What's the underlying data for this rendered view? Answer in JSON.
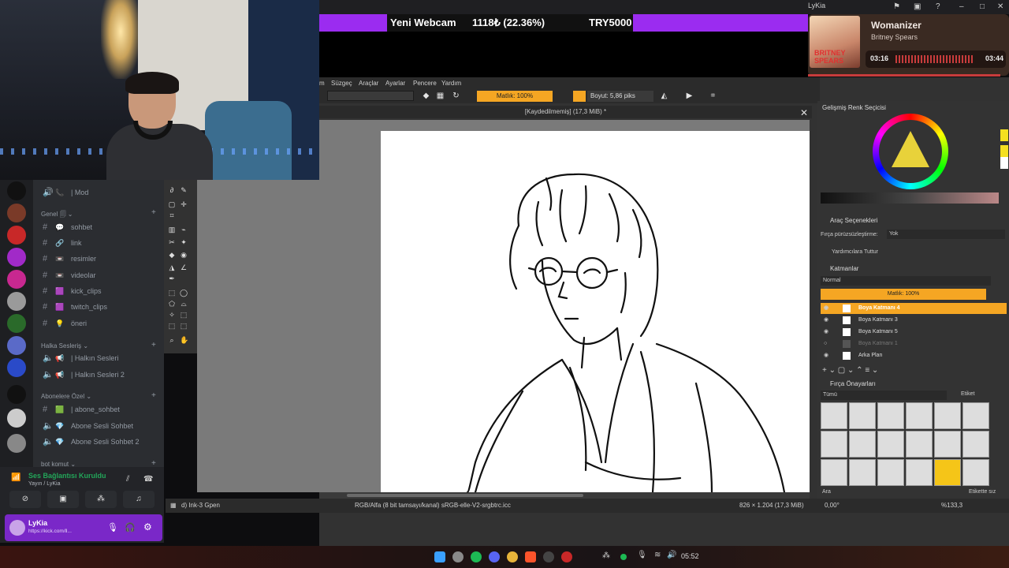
{
  "window": {
    "title": "LyKia"
  },
  "alert": {
    "label": "Yeni Webcam",
    "amount": "1118₺ (22.36%)",
    "goal": "TRY5000"
  },
  "music": {
    "title": "Womanizer",
    "artist": "Britney Spears",
    "elapsed": "03:16",
    "total": "03:44",
    "album_text": "BRITNEY SPEARS"
  },
  "krita": {
    "menu": [
      "m",
      "Süzgeç",
      "Araçlar",
      "Ayarlar",
      "Pencere",
      "Yardım"
    ],
    "opacity_label": "Matlık: 100%",
    "size_label": "Boyut: 5,86 piks",
    "document_title": "[Kaydedilmemiş]  (17,3 MiB) *",
    "status": {
      "brush": "d) Ink-3 Gpen",
      "color_profile": "RGB/Alfa (8 bit tamsayı/kanal) sRGB-elle-V2-srgbtrc.icc",
      "dimensions": "826 × 1.204 (17,3 MiB)",
      "rotation": "0,00°",
      "zoom": "%133,3"
    },
    "panels": {
      "color_selector": "Gelişmiş Renk Seçicisi",
      "tool_options": "Araç Seçenekleri",
      "smoothing_label": "Fırça pürüzsüzleştirme:",
      "smoothing_value": "Yok",
      "assistants_label": "Yardımcılara Tuttur",
      "layers": "Katmanlar",
      "blend_mode": "Normal",
      "layer_opacity": "Matlık:  100%",
      "layer_list": [
        {
          "name": "Boya Katmanı 4",
          "active": true,
          "dim": false
        },
        {
          "name": "Boya Katmanı 3",
          "active": false,
          "dim": false
        },
        {
          "name": "Boya Katmanı 5",
          "active": false,
          "dim": false
        },
        {
          "name": "Boya Katmanı 1",
          "active": false,
          "dim": true
        },
        {
          "name": "Arka Plan",
          "active": false,
          "dim": false
        }
      ],
      "brush_presets": "Fırça Önayarları",
      "presets_filter": "Tümü",
      "tag_label": "Etiket",
      "search_label": "Ara",
      "tag_search": "Etikette sız"
    }
  },
  "discord": {
    "top_channel": "| Mod",
    "categories": [
      {
        "name": "Genel 🗐 ⌄"
      },
      {
        "name": "Halka Sesleriş ⌄"
      },
      {
        "name": "Abonelere Özel ⌄"
      },
      {
        "name": "bot komut ⌄"
      }
    ],
    "channels": [
      {
        "emoji": "💬",
        "label": "sohbet",
        "type": "text"
      },
      {
        "emoji": "🔗",
        "label": "link",
        "type": "text"
      },
      {
        "emoji": "📼",
        "label": "resimler",
        "type": "text"
      },
      {
        "emoji": "📼",
        "label": "videolar",
        "type": "text"
      },
      {
        "emoji": "🟪",
        "label": "kick_clips",
        "type": "text"
      },
      {
        "emoji": "🟪",
        "label": "twitch_clips",
        "type": "text"
      },
      {
        "emoji": "💡",
        "label": "öneri",
        "type": "text"
      },
      {
        "emoji": "📢",
        "label": "| Halkın Sesleri",
        "type": "voice"
      },
      {
        "emoji": "📢",
        "label": "| Halkın Sesleri 2",
        "type": "voice"
      },
      {
        "emoji": "🟩",
        "label": "| abone_sohbet",
        "type": "text"
      },
      {
        "emoji": "💎",
        "label": "Abone Sesli Sohbet",
        "type": "voice"
      },
      {
        "emoji": "💎",
        "label": "Abone Sesli Sohbet 2",
        "type": "voice"
      }
    ],
    "voice": {
      "status": "Ses Bağlantısı Kuruldu",
      "channel": "Yayın / LyKia"
    },
    "user": {
      "name": "LyKia",
      "status": "https://kick.com/ll..."
    }
  },
  "taskbar": {
    "time": "05:52"
  },
  "colors": {
    "accent": "#f5a623",
    "discord_purple": "#7a28c8",
    "alert_purple": "#9b2cf0"
  }
}
